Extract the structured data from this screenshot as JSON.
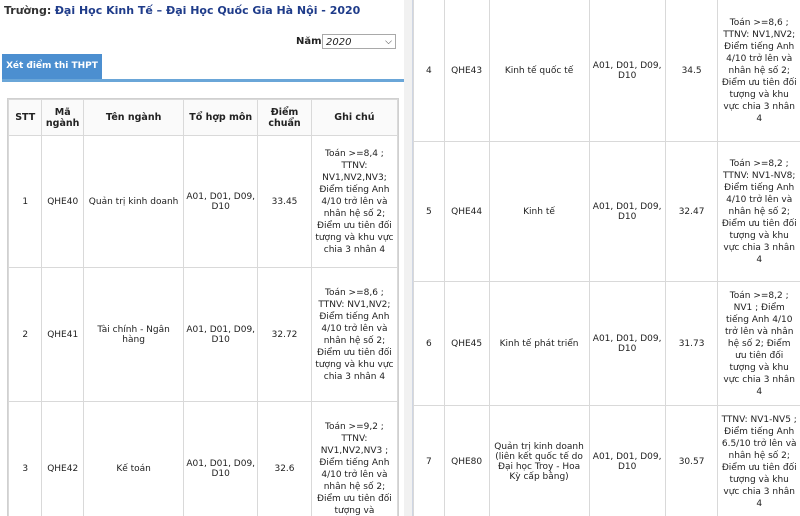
{
  "header": {
    "school_label": "Trường:",
    "school_name": "Đại Học Kinh Tế – Đại Học Quốc Gia Hà Nội - 2020",
    "year_label": "Năm:",
    "year_value": "2020"
  },
  "tabs": {
    "active": "Xét điểm thi THPT"
  },
  "table": {
    "headers": {
      "stt": "STT",
      "code": "Mã ngành",
      "name": "Tên ngành",
      "combo": "Tổ hợp môn",
      "score": "Điểm chuẩn",
      "note": "Ghi chú"
    },
    "rows": [
      {
        "stt": "1",
        "code": "QHE40",
        "name": "Quản trị kinh doanh",
        "combo": "A01, D01, D09, D10",
        "score": "33.45",
        "note": "Toán >=8,4 ; TTNV: NV1,NV2,NV3; Điểm tiếng Anh 4/10 trở lên và nhân hệ số 2; Điểm ưu tiên đối tượng và khu vực chia 3 nhân 4"
      },
      {
        "stt": "2",
        "code": "QHE41",
        "name": "Tài chính - Ngân hàng",
        "combo": "A01, D01, D09, D10",
        "score": "32.72",
        "note": "Toán >=8,6 ; TTNV: NV1,NV2; Điểm tiếng Anh 4/10 trở lên và nhân hệ số 2; Điểm ưu tiên đối tượng và khu vực chia 3 nhân 4"
      },
      {
        "stt": "3",
        "code": "QHE42",
        "name": "Kế toán",
        "combo": "A01, D01, D09, D10",
        "score": "32.6",
        "note": "Toán >=9,2 ; TTNV: NV1,NV2,NV3 ; Điểm tiếng Anh 4/10 trở lên và nhân hệ số 2; Điểm ưu tiên đối tượng và"
      },
      {
        "stt": "4",
        "code": "QHE43",
        "name": "Kinh tế quốc tế",
        "combo": "A01, D01, D09, D10",
        "score": "34.5",
        "note": "Toán >=8,6 ; TTNV: NV1,NV2; Điểm tiếng Anh 4/10 trở lên và nhân hệ số 2; Điểm ưu tiên đối tượng và khu vực chia 3 nhân 4"
      },
      {
        "stt": "5",
        "code": "QHE44",
        "name": "Kinh tế",
        "combo": "A01, D01, D09, D10",
        "score": "32.47",
        "note": "Toán >=8,2 ; TTNV: NV1-NV8; Điểm tiếng Anh 4/10 trở lên và nhân hệ số 2; Điểm ưu tiên đối tượng và khu vực chia 3 nhân 4"
      },
      {
        "stt": "6",
        "code": "QHE45",
        "name": "Kinh tế phát triển",
        "combo": "A01, D01, D09, D10",
        "score": "31.73",
        "note": "Toán >=8,2 ; NV1 ; Điểm tiếng Anh 4/10 trở lên và nhân hệ số 2; Điểm ưu tiên đối tượng và khu vực chia 3 nhân 4"
      },
      {
        "stt": "7",
        "code": "QHE80",
        "name": "Quản trị kinh doanh (liên kết quốc tế do Đại học Troy - Hoa Kỳ cấp bằng)",
        "combo": "A01, D01, D09, D10",
        "score": "30.57",
        "note": "TTNV: NV1-NV5 ; Điểm tiếng Anh 6.5/10 trở lên và nhân hệ số 2; Điểm ưu tiên đối tượng và khu vực chia 3 nhân 4"
      }
    ]
  }
}
